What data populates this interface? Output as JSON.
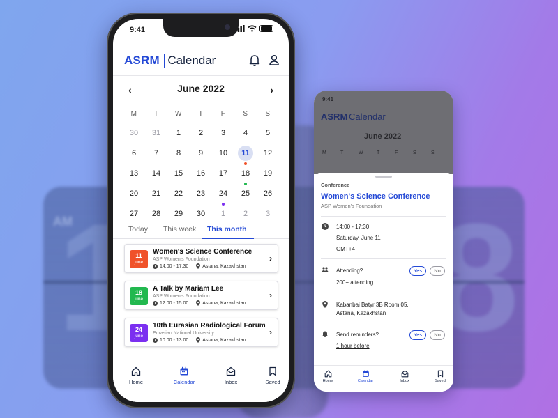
{
  "status": {
    "time": "9:41"
  },
  "header": {
    "brand": "ASRM",
    "title": "Calendar"
  },
  "calendar": {
    "month_label": "June 2022",
    "weekdays": [
      "M",
      "T",
      "W",
      "T",
      "F",
      "S",
      "S"
    ],
    "weeks": [
      [
        "30",
        "31",
        "1",
        "2",
        "3",
        "4",
        "5"
      ],
      [
        "6",
        "7",
        "8",
        "9",
        "10",
        "11",
        "12"
      ],
      [
        "13",
        "14",
        "15",
        "16",
        "17",
        "18",
        "19"
      ],
      [
        "20",
        "21",
        "22",
        "23",
        "24",
        "25",
        "26"
      ],
      [
        "27",
        "28",
        "29",
        "30",
        "1",
        "2",
        "3"
      ]
    ],
    "selected_day": "11"
  },
  "filters": {
    "today": "Today",
    "this_week": "This week",
    "this_month": "This month",
    "active": "this_month"
  },
  "events": [
    {
      "day": "11",
      "month": "june",
      "title": "Women's Science Conference",
      "org": "ASP Women's Foundation",
      "time": "14:00 - 17:30",
      "location": "Astana, Kazakhstan",
      "color": "#f0522a"
    },
    {
      "day": "18",
      "month": "june",
      "title": "A Talk by Mariam Lee",
      "org": "ASP Women's Foundation",
      "time": "12:00 - 15:00",
      "location": "Astana, Kazakhstan",
      "color": "#22b84f"
    },
    {
      "day": "24",
      "month": "june",
      "title": "10th Eurasian Radiological Forum",
      "org": "Eurasian National University",
      "time": "10:00 - 13:00",
      "location": "Astana, Kazakhstan",
      "color": "#7b2ff0"
    }
  ],
  "nav": {
    "home": "Home",
    "calendar": "Calendar",
    "inbox": "Inbox",
    "saved": "Saved"
  },
  "detail": {
    "status_time": "9:41",
    "brand": "ASRM",
    "title": "Calendar",
    "month_label": "June 2022",
    "weekdays": [
      "M",
      "T",
      "W",
      "T",
      "F",
      "S",
      "S"
    ],
    "category": "Conference",
    "event_title": "Women's Science Conference",
    "event_org": "ASP Women's Foundation",
    "time": "14:00 - 17:30",
    "date": "Saturday, June 11",
    "timezone": "GMT+4",
    "attending_label": "Attending?",
    "attending_count": "200+ attending",
    "yes": "Yes",
    "no": "No",
    "address_line1": "Kabanbai Batyr 3B Room 05,",
    "address_line2": "Astana, Kazakhstan",
    "reminders_label": "Send reminders?",
    "reminder_value": "1 hour before"
  },
  "colors": {
    "accent": "#2449d6",
    "selected_bg": "#d9dff3",
    "dot_red": "#f0522a",
    "dot_green": "#22b84f",
    "dot_purple": "#7b2ff0"
  }
}
